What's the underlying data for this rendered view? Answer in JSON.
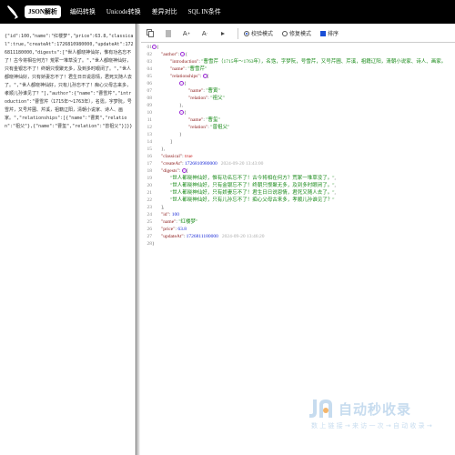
{
  "nav": {
    "tabs": [
      "JSON解析",
      "编码转换",
      "Unicode转换",
      "差异对比",
      "SQL IN条件"
    ]
  },
  "left": {
    "raw": "{\"id\":100,\"name\":\"红楼梦\",\"price\":63.8,\"classical\":true,\"createAt\":1726810980000,\"updateAt\":1726811180000,\"digests\":[\"世人都晓神仙好，惟有功名忘不了！古今将相在何方？荒冢一堆草没了。\",\"世人都晓神仙好，只有金银忘不了！终朝只恨聚无多，及到多时眼闭了。\",\"世人都晓神仙好，只有娇妻忘不了！君生日日说恩情，君死又随人去了。\",\"世人都晓神仙好，只有儿孙忘不了！痴心父母古来多，孝顺儿孙谁见了？\"],\"author\":{\"name\":\"曹雪芹\",\"introduction\":\"曹雪芹（1715年～1763年），名霑，字梦阮，号雪芹，又号芹圃、芹溪，祖籍辽阳，清朝小说家、诗人、画家。\",\"relationships\":[{\"name\":\"曹寅\",\"relation\":\"祖父\"},{\"name\":\"曹玺\",\"relation\":\"曾祖父\"}]}}"
  },
  "toolbar": {
    "opt1": "校验模式",
    "opt2": "修复模式",
    "opt3": "排序"
  },
  "json": {
    "k_author": "\"author\"",
    "k_intro": "\"introduction\"",
    "v_intro": "\"曹雪芹（1715年～1763年），名霑，字梦阮，号雪芹，又号芹圃、芹溪，祖籍辽阳，清朝小说家、诗人、画家。",
    "k_name": "\"name\"",
    "v_author_name": "\"曹雪芹\"",
    "k_rel": "\"relationships\"",
    "v_rel1_name": "\"曹寅\"",
    "k_relation": "\"relation\"",
    "v_rel1_rel": "\"祖父\"",
    "v_rel2_name": "\"曹玺\"",
    "v_rel2_rel": "\"曾祖父\"",
    "k_classical": "\"classical\"",
    "v_classical": "true",
    "k_createAt": "\"createAt\"",
    "v_createAt": "1726810980000",
    "d_createAt": "2024-09-20 13:43:00",
    "k_digests": "\"digests\"",
    "dig1": "\"世人都晓神仙好，惟有功名忘不了！古今将相在何方？荒冢一堆草没了。\"",
    "dig2": "\"世人都晓神仙好，只有金银忘不了！终朝只恨聚无多，及到多时眼闭了。\"",
    "dig3": "\"世人都晓神仙好，只有娇妻忘不了！君生日日说恩情，君死又随人去了。\"",
    "dig4": "\"世人都晓神仙好，只有儿孙忘不了！痴心父母古来多，孝顺儿孙谁见了？\"",
    "k_id": "\"id\"",
    "v_id": "100",
    "v_name": "\"红楼梦\"",
    "k_price": "\"price\"",
    "v_price": "63.8",
    "k_updateAt": "\"updateAt\"",
    "v_updateAt": "1726811180000",
    "d_updateAt": "2024-09-20 13:46:20"
  },
  "watermark": {
    "title": "自动秒收录",
    "subtitle": "数 上 链 接 → 来 访 一 次 → 自 动 收 录 →"
  },
  "colors": {
    "topbar": "#000000",
    "key": "#8b1a1a",
    "string": "#1a8b1a",
    "number": "#1a2ad6",
    "boolean": "#c81e1e"
  }
}
